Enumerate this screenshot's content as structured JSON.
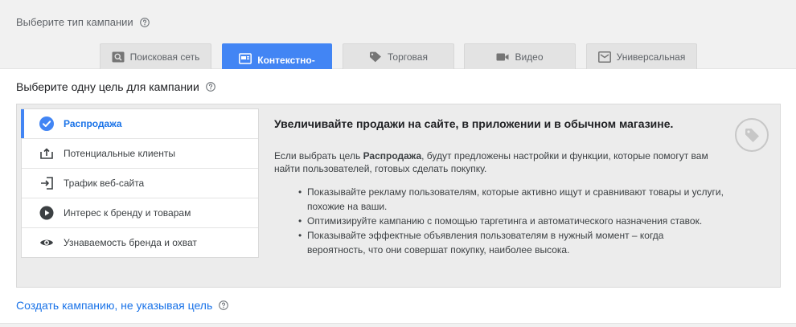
{
  "campaign_type": {
    "title": "Выберите тип кампании",
    "tabs": [
      {
        "label": "Поисковая сеть",
        "icon": "search-icon",
        "active": false
      },
      {
        "label": "Контекстно-",
        "icon": "display-icon",
        "active": true
      },
      {
        "label": "Торговая",
        "icon": "shopping-tag-icon",
        "active": false
      },
      {
        "label": "Видео",
        "icon": "video-icon",
        "active": false
      },
      {
        "label": "Универсальная",
        "icon": "universal-icon",
        "active": false
      }
    ]
  },
  "goal": {
    "title": "Выберите одну цель для кампании",
    "items": [
      {
        "label": "Распродажа",
        "icon": "check-circle-icon",
        "selected": true
      },
      {
        "label": "Потенциальные клиенты",
        "icon": "leads-icon",
        "selected": false
      },
      {
        "label": "Трафик веб-сайта",
        "icon": "website-traffic-icon",
        "selected": false
      },
      {
        "label": "Интерес к бренду и товарам",
        "icon": "play-circle-icon",
        "selected": false
      },
      {
        "label": "Узнаваемость бренда и охват",
        "icon": "eye-icon",
        "selected": false
      }
    ],
    "detail": {
      "heading": "Увеличивайте продажи на сайте, в приложении и в обычном магазине.",
      "intro_before": "Если выбрать цель ",
      "intro_bold": "Распродажа",
      "intro_after": ", будут предложены настройки и функции, которые помогут вам найти пользователей, готовых сделать покупку.",
      "bullets": [
        "Показывайте рекламу пользователям, которые активно ищут и сравнивают товары и услуги, похожие на ваши.",
        "Оптимизируйте кампанию с помощью таргетинга и автоматического назначения ставок.",
        "Показывайте эффектные объявления пользователям в нужный момент – когда вероятность, что они совершат покупку, наиболее высока."
      ],
      "badge_icon": "tag-icon"
    }
  },
  "create_without_goal": "Создать кампанию, не указывая цель",
  "colors": {
    "accent": "#4285f4",
    "link": "#1a73e8",
    "panel_bg": "#ececec",
    "header_bg": "#f1f1f1"
  }
}
